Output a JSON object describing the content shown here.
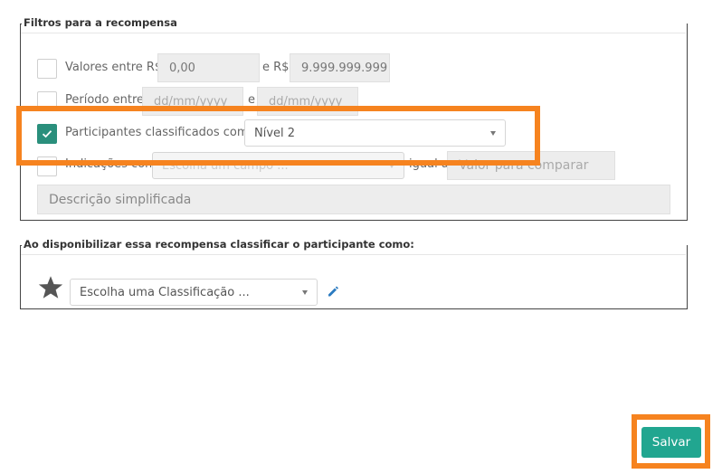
{
  "filters": {
    "legend": "Filtros para a recompensa",
    "valores": {
      "label": "Valores entre R$",
      "min": "0,00",
      "mid_label": "e R$",
      "max": "9.999.999.999"
    },
    "periodo": {
      "label": "Período entre",
      "start_placeholder": "dd/mm/yyyy",
      "mid_label": "e",
      "end_placeholder": "dd/mm/yyyy"
    },
    "participantes": {
      "label": "Participantes classificados como",
      "value": "Nível 2",
      "checked": true
    },
    "indicacoes": {
      "label": "Indicações com",
      "field_placeholder": "Escolha um campo ...",
      "compare_label": "igual a",
      "value_placeholder": "Valor para comparar"
    },
    "descricao_placeholder": "Descrição simplificada"
  },
  "classificacao": {
    "legend": "Ao disponibilizar essa recompensa classificar o participante como:",
    "select_placeholder": "Escolha uma Classificação ..."
  },
  "actions": {
    "save_label": "Salvar"
  },
  "colors": {
    "accent": "#21a690",
    "checkbox_checked": "#2a8f7c",
    "highlight": "#f6831f",
    "icon_blue": "#2b7bc0"
  },
  "icons": {
    "star": "star-icon",
    "edit": "pencil-icon",
    "check": "check-icon"
  }
}
